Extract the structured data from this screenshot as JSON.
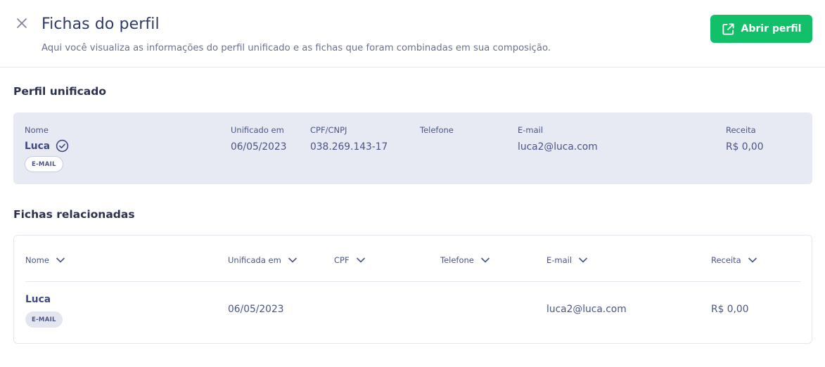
{
  "header": {
    "title": "Fichas do perfil",
    "subtitle": "Aqui você visualiza as informações do perfil unificado e as fichas que foram combinadas em sua composição.",
    "open_profile_label": "Abrir perfil"
  },
  "unified_profile": {
    "section_title": "Perfil unificado",
    "labels": {
      "name": "Nome",
      "unified_at": "Unificado em",
      "document": "CPF/CNPJ",
      "phone": "Telefone",
      "email": "E-mail",
      "revenue": "Receita"
    },
    "name": "Luca",
    "badge": "E-MAIL",
    "unified_at": "06/05/2023",
    "document": "038.269.143-17",
    "phone": "",
    "email": "luca2@luca.com",
    "revenue": "R$ 0,00"
  },
  "related": {
    "section_title": "Fichas relacionadas",
    "columns": {
      "name": "Nome",
      "unified_at": "Unificada em",
      "cpf": "CPF",
      "phone": "Telefone",
      "email": "E-mail",
      "revenue": "Receita"
    },
    "rows": [
      {
        "name": "Luca",
        "badge": "E-MAIL",
        "unified_at": "06/05/2023",
        "cpf": "",
        "phone": "",
        "email": "luca2@luca.com",
        "revenue": "R$ 0,00"
      }
    ]
  },
  "colors": {
    "accent_green": "#12c06a",
    "primary_text": "#2f3a66",
    "card_bg": "#e7eaf3"
  },
  "icons": {
    "close": "close-icon",
    "open_external": "external-link-icon",
    "verified": "check-circle-icon",
    "sort": "chevron-down-icon"
  }
}
